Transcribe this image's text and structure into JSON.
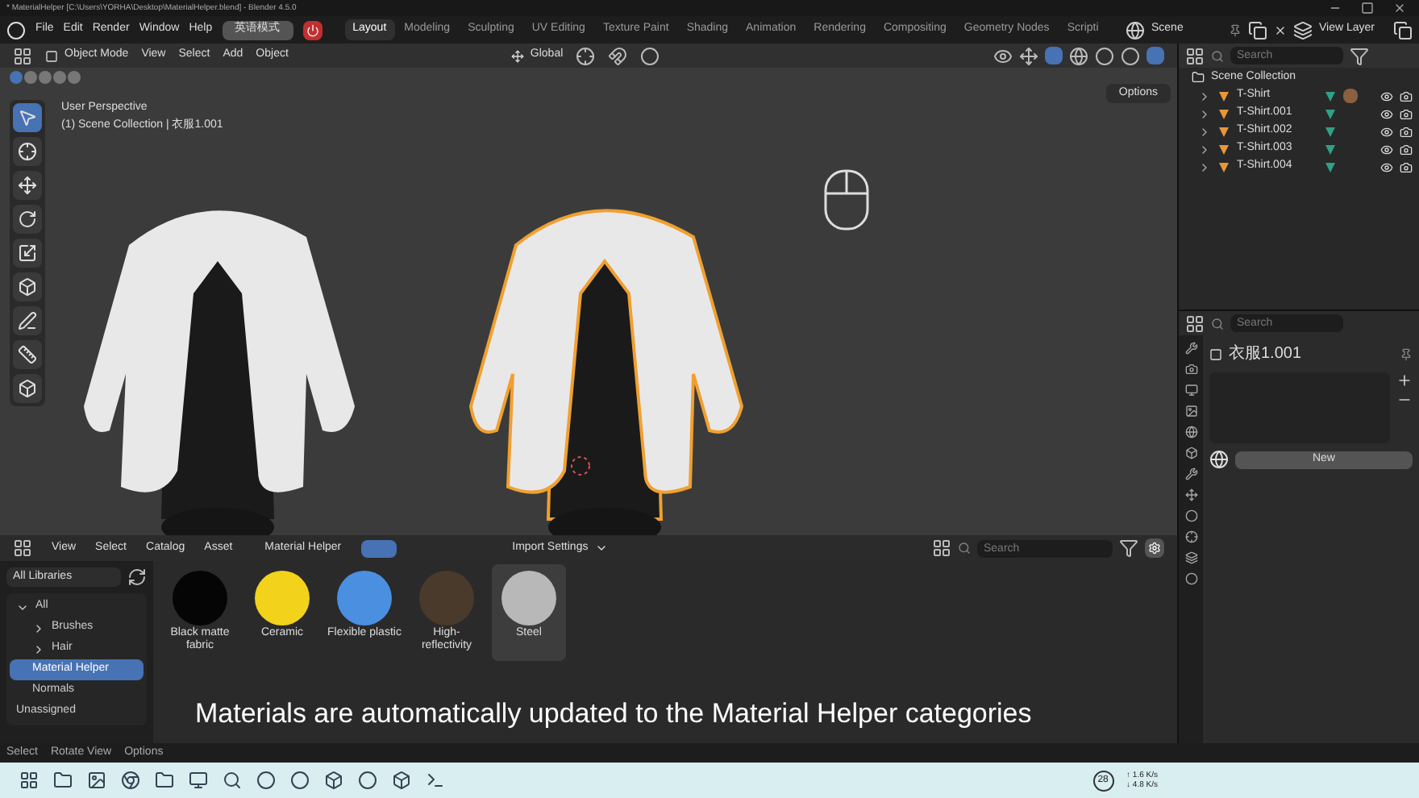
{
  "title_bar": {
    "title": "* MaterialHelper [C:\\Users\\YORHA\\Desktop\\MaterialHelper.blend] - Blender 4.5.0"
  },
  "menu_bar": {
    "menus": [
      "File",
      "Edit",
      "Render",
      "Window",
      "Help"
    ],
    "mode_button": "英语模式",
    "workspaces": [
      {
        "label": "Layout",
        "selected": true
      },
      {
        "label": "Modeling",
        "selected": false
      },
      {
        "label": "Sculpting",
        "selected": false
      },
      {
        "label": "UV Editing",
        "selected": false
      },
      {
        "label": "Texture Paint",
        "selected": false
      },
      {
        "label": "Shading",
        "selected": false
      },
      {
        "label": "Animation",
        "selected": false
      },
      {
        "label": "Rendering",
        "selected": false
      },
      {
        "label": "Compositing",
        "selected": false
      },
      {
        "label": "Geometry Nodes",
        "selected": false
      },
      {
        "label": "Scripti",
        "selected": false
      }
    ],
    "scene": "Scene",
    "view_layer": "View Layer"
  },
  "viewport": {
    "mode": "Object Mode",
    "menus": [
      "View",
      "Select",
      "Add",
      "Object"
    ],
    "orientation": "Global",
    "options": "Options",
    "perspective": "User Perspective",
    "collection": "(1) Scene Collection | 衣服1.001",
    "tools": [
      {
        "selected": true
      },
      {
        "selected": false
      },
      {
        "selected": false
      },
      {
        "selected": false
      },
      {
        "selected": false
      },
      {
        "selected": false
      },
      {
        "selected": false
      },
      {
        "selected": false
      },
      {
        "selected": false
      }
    ]
  },
  "outliner": {
    "search_placeholder": "Search",
    "root": "Scene Collection",
    "items": [
      {
        "label": "T-Shirt",
        "selected": true
      },
      {
        "label": "T-Shirt.001",
        "selected": false
      },
      {
        "label": "T-Shirt.002",
        "selected": false
      },
      {
        "label": "T-Shirt.003",
        "selected": false
      },
      {
        "label": "T-Shirt.004",
        "selected": false
      }
    ]
  },
  "properties": {
    "search_placeholder": "Search",
    "object": "衣服1.001",
    "new_button": "New"
  },
  "asset_browser": {
    "menus": [
      "View",
      "Select",
      "Catalog",
      "Asset"
    ],
    "library": "Material Helper",
    "import_settings": "Import Settings",
    "search_placeholder": "Search",
    "library_select": "All Libraries",
    "catalogs": [
      {
        "label": "All",
        "expanded": true,
        "selected": false,
        "children": [
          {
            "label": "Brushes",
            "expanded": false,
            "selected": false
          },
          {
            "label": "Hair",
            "expanded": false,
            "selected": false
          },
          {
            "label": "Material Helper",
            "selected": true
          },
          {
            "label": "Normals",
            "selected": false
          }
        ]
      },
      {
        "label": "Unassigned",
        "selected": false
      }
    ],
    "assets": [
      {
        "name": "Black matte fabric",
        "color": "#050505",
        "selected": false
      },
      {
        "name": "Ceramic",
        "color": "#f2d21a",
        "selected": false
      },
      {
        "name": "Flexible plastic",
        "color": "#4a8fe0",
        "selected": false
      },
      {
        "name": "High-reflectivity",
        "color": "#4a3a2c",
        "selected": false
      },
      {
        "name": "Steel",
        "color": "#b8b8b8",
        "selected": true
      }
    ]
  },
  "caption": "Materials are automatically updated to the Material Helper categories",
  "status_bar": {
    "items": [
      "Select",
      "Rotate View",
      "Options"
    ]
  },
  "taskbar": {
    "badge": "28",
    "upload": "↑ 1.6 K/s",
    "download": "↓ 4.8 K/s"
  }
}
